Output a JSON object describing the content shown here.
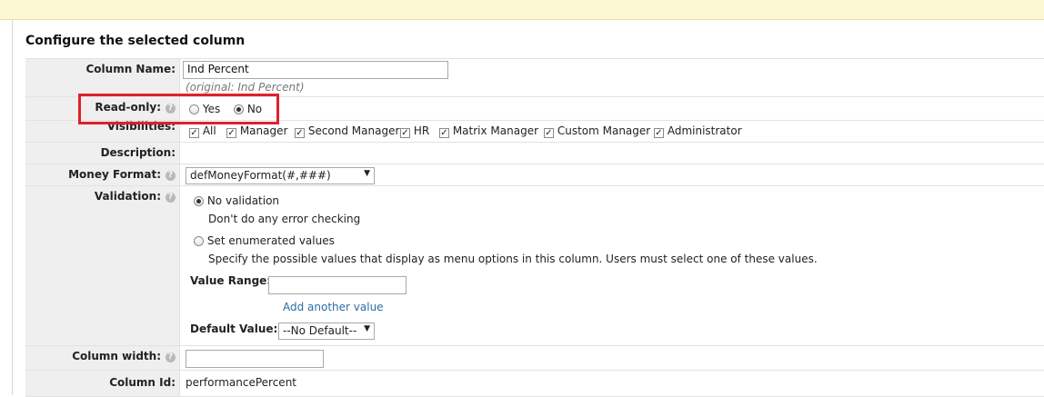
{
  "page": {
    "title": "Configure the selected column"
  },
  "column_name": {
    "label": "Column Name:",
    "value": "Ind Percent",
    "original": "(original: Ind Percent)"
  },
  "read_only": {
    "label": "Read-only:",
    "options": [
      "Yes",
      "No"
    ],
    "selected": "No"
  },
  "visibilities": {
    "label": "Visibilities:",
    "items": [
      {
        "label": "All",
        "checked": true
      },
      {
        "label": "Manager",
        "checked": true
      },
      {
        "label": "Second Manager",
        "checked": true
      },
      {
        "label": "HR",
        "checked": true
      },
      {
        "label": "Matrix Manager",
        "checked": true
      },
      {
        "label": "Custom Manager",
        "checked": true
      },
      {
        "label": "Administrator",
        "checked": true
      }
    ]
  },
  "description": {
    "label": "Description:"
  },
  "money_format": {
    "label": "Money Format:",
    "selected": "defMoneyFormat(#,###)"
  },
  "validation": {
    "label": "Validation:",
    "no_validation": {
      "title": "No validation",
      "desc": "Don't do any error checking",
      "selected": true
    },
    "enumerated": {
      "title": "Set enumerated values",
      "desc": "Specify the possible values that display as menu options in this column. Users must select one of these values.",
      "selected": false
    },
    "value_range_label": "Value Range:",
    "value_range_value": "",
    "add_another": "Add another value",
    "default_value_label": "Default Value:",
    "default_value_selected": "--No Default--"
  },
  "column_width": {
    "label": "Column width:",
    "value": ""
  },
  "column_id": {
    "label": "Column Id:",
    "value": "performancePercent"
  },
  "icons": {
    "help": "help-icon",
    "check": "checkmark-icon",
    "dropdown": "chevron-down-icon"
  },
  "colors": {
    "highlight": "#e0202a",
    "link": "#2a6ea6",
    "label_bg": "#efefef",
    "topbar_bg": "#fcf8d3"
  }
}
